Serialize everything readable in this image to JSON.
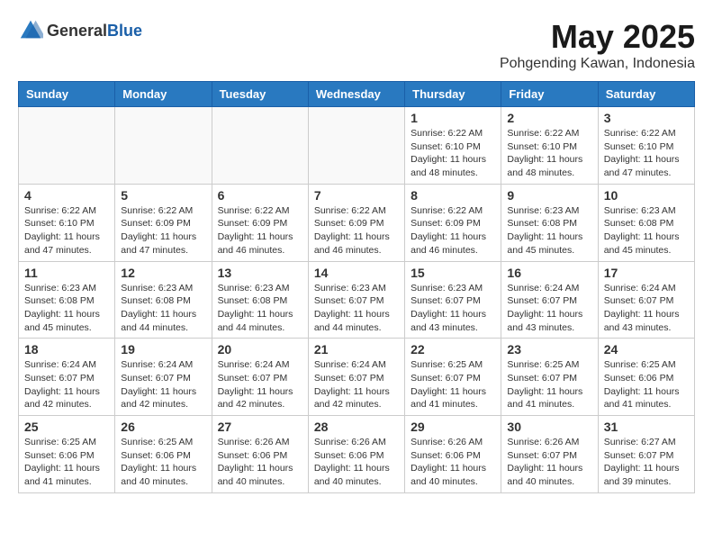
{
  "header": {
    "logo_general": "General",
    "logo_blue": "Blue",
    "title": "May 2025",
    "subtitle": "Pohgending Kawan, Indonesia"
  },
  "days_of_week": [
    "Sunday",
    "Monday",
    "Tuesday",
    "Wednesday",
    "Thursday",
    "Friday",
    "Saturday"
  ],
  "weeks": [
    [
      {
        "day": "",
        "info": ""
      },
      {
        "day": "",
        "info": ""
      },
      {
        "day": "",
        "info": ""
      },
      {
        "day": "",
        "info": ""
      },
      {
        "day": "1",
        "info": "Sunrise: 6:22 AM\nSunset: 6:10 PM\nDaylight: 11 hours\nand 48 minutes."
      },
      {
        "day": "2",
        "info": "Sunrise: 6:22 AM\nSunset: 6:10 PM\nDaylight: 11 hours\nand 48 minutes."
      },
      {
        "day": "3",
        "info": "Sunrise: 6:22 AM\nSunset: 6:10 PM\nDaylight: 11 hours\nand 47 minutes."
      }
    ],
    [
      {
        "day": "4",
        "info": "Sunrise: 6:22 AM\nSunset: 6:10 PM\nDaylight: 11 hours\nand 47 minutes."
      },
      {
        "day": "5",
        "info": "Sunrise: 6:22 AM\nSunset: 6:09 PM\nDaylight: 11 hours\nand 47 minutes."
      },
      {
        "day": "6",
        "info": "Sunrise: 6:22 AM\nSunset: 6:09 PM\nDaylight: 11 hours\nand 46 minutes."
      },
      {
        "day": "7",
        "info": "Sunrise: 6:22 AM\nSunset: 6:09 PM\nDaylight: 11 hours\nand 46 minutes."
      },
      {
        "day": "8",
        "info": "Sunrise: 6:22 AM\nSunset: 6:09 PM\nDaylight: 11 hours\nand 46 minutes."
      },
      {
        "day": "9",
        "info": "Sunrise: 6:23 AM\nSunset: 6:08 PM\nDaylight: 11 hours\nand 45 minutes."
      },
      {
        "day": "10",
        "info": "Sunrise: 6:23 AM\nSunset: 6:08 PM\nDaylight: 11 hours\nand 45 minutes."
      }
    ],
    [
      {
        "day": "11",
        "info": "Sunrise: 6:23 AM\nSunset: 6:08 PM\nDaylight: 11 hours\nand 45 minutes."
      },
      {
        "day": "12",
        "info": "Sunrise: 6:23 AM\nSunset: 6:08 PM\nDaylight: 11 hours\nand 44 minutes."
      },
      {
        "day": "13",
        "info": "Sunrise: 6:23 AM\nSunset: 6:08 PM\nDaylight: 11 hours\nand 44 minutes."
      },
      {
        "day": "14",
        "info": "Sunrise: 6:23 AM\nSunset: 6:07 PM\nDaylight: 11 hours\nand 44 minutes."
      },
      {
        "day": "15",
        "info": "Sunrise: 6:23 AM\nSunset: 6:07 PM\nDaylight: 11 hours\nand 43 minutes."
      },
      {
        "day": "16",
        "info": "Sunrise: 6:24 AM\nSunset: 6:07 PM\nDaylight: 11 hours\nand 43 minutes."
      },
      {
        "day": "17",
        "info": "Sunrise: 6:24 AM\nSunset: 6:07 PM\nDaylight: 11 hours\nand 43 minutes."
      }
    ],
    [
      {
        "day": "18",
        "info": "Sunrise: 6:24 AM\nSunset: 6:07 PM\nDaylight: 11 hours\nand 42 minutes."
      },
      {
        "day": "19",
        "info": "Sunrise: 6:24 AM\nSunset: 6:07 PM\nDaylight: 11 hours\nand 42 minutes."
      },
      {
        "day": "20",
        "info": "Sunrise: 6:24 AM\nSunset: 6:07 PM\nDaylight: 11 hours\nand 42 minutes."
      },
      {
        "day": "21",
        "info": "Sunrise: 6:24 AM\nSunset: 6:07 PM\nDaylight: 11 hours\nand 42 minutes."
      },
      {
        "day": "22",
        "info": "Sunrise: 6:25 AM\nSunset: 6:07 PM\nDaylight: 11 hours\nand 41 minutes."
      },
      {
        "day": "23",
        "info": "Sunrise: 6:25 AM\nSunset: 6:07 PM\nDaylight: 11 hours\nand 41 minutes."
      },
      {
        "day": "24",
        "info": "Sunrise: 6:25 AM\nSunset: 6:06 PM\nDaylight: 11 hours\nand 41 minutes."
      }
    ],
    [
      {
        "day": "25",
        "info": "Sunrise: 6:25 AM\nSunset: 6:06 PM\nDaylight: 11 hours\nand 41 minutes."
      },
      {
        "day": "26",
        "info": "Sunrise: 6:25 AM\nSunset: 6:06 PM\nDaylight: 11 hours\nand 40 minutes."
      },
      {
        "day": "27",
        "info": "Sunrise: 6:26 AM\nSunset: 6:06 PM\nDaylight: 11 hours\nand 40 minutes."
      },
      {
        "day": "28",
        "info": "Sunrise: 6:26 AM\nSunset: 6:06 PM\nDaylight: 11 hours\nand 40 minutes."
      },
      {
        "day": "29",
        "info": "Sunrise: 6:26 AM\nSunset: 6:06 PM\nDaylight: 11 hours\nand 40 minutes."
      },
      {
        "day": "30",
        "info": "Sunrise: 6:26 AM\nSunset: 6:07 PM\nDaylight: 11 hours\nand 40 minutes."
      },
      {
        "day": "31",
        "info": "Sunrise: 6:27 AM\nSunset: 6:07 PM\nDaylight: 11 hours\nand 39 minutes."
      }
    ]
  ]
}
